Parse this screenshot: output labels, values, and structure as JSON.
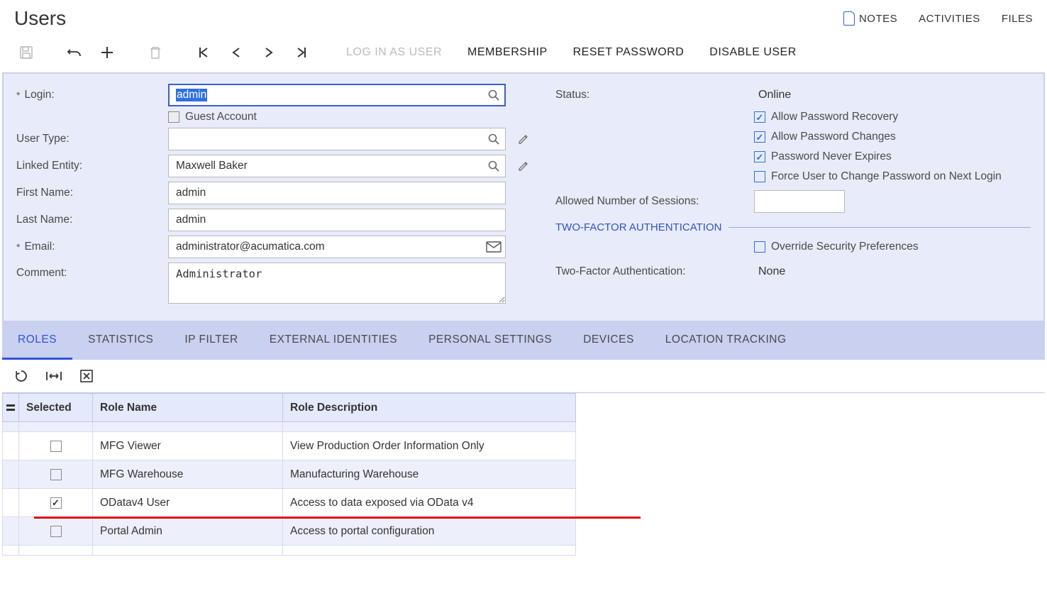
{
  "header": {
    "title": "Users",
    "notes": "NOTES",
    "activities": "ACTIVITIES",
    "files": "FILES"
  },
  "toolbar": {
    "login_as_user": "LOG IN AS USER",
    "membership": "MEMBERSHIP",
    "reset_password": "RESET PASSWORD",
    "disable_user": "DISABLE USER"
  },
  "form": {
    "login_label": "Login:",
    "login_value": "admin",
    "guest_account_label": "Guest Account",
    "user_type_label": "User Type:",
    "user_type_value": "",
    "linked_entity_label": "Linked Entity:",
    "linked_entity_value": "Maxwell Baker",
    "first_name_label": "First Name:",
    "first_name_value": "admin",
    "last_name_label": "Last Name:",
    "last_name_value": "admin",
    "email_label": "Email:",
    "email_value": "administrator@acumatica.com",
    "comment_label": "Comment:",
    "comment_value": "Administrator",
    "status_label": "Status:",
    "status_value": "Online",
    "allow_pw_recovery": "Allow Password Recovery",
    "allow_pw_changes": "Allow Password Changes",
    "pw_never_expires": "Password Never Expires",
    "force_change": "Force User to Change Password on Next Login",
    "allowed_sessions_label": "Allowed Number of Sessions:",
    "two_factor_section": "TWO-FACTOR AUTHENTICATION",
    "override_sec": "Override Security Preferences",
    "two_factor_label": "Two-Factor Authentication:",
    "two_factor_value": "None"
  },
  "tabs": {
    "roles": "ROLES",
    "statistics": "STATISTICS",
    "ip_filter": "IP FILTER",
    "external_identities": "EXTERNAL IDENTITIES",
    "personal_settings": "PERSONAL SETTINGS",
    "devices": "DEVICES",
    "location_tracking": "LOCATION TRACKING"
  },
  "grid": {
    "col_selected": "Selected",
    "col_role_name": "Role Name",
    "col_role_desc": "Role Description",
    "rows": [
      {
        "selected": false,
        "name": "MFG Viewer",
        "desc": "View Production Order Information Only"
      },
      {
        "selected": false,
        "name": "MFG Warehouse",
        "desc": "Manufacturing Warehouse"
      },
      {
        "selected": true,
        "name": "ODatav4 User",
        "desc": "Access to data exposed via OData v4"
      },
      {
        "selected": false,
        "name": "Portal Admin",
        "desc": "Access to portal configuration"
      }
    ]
  }
}
